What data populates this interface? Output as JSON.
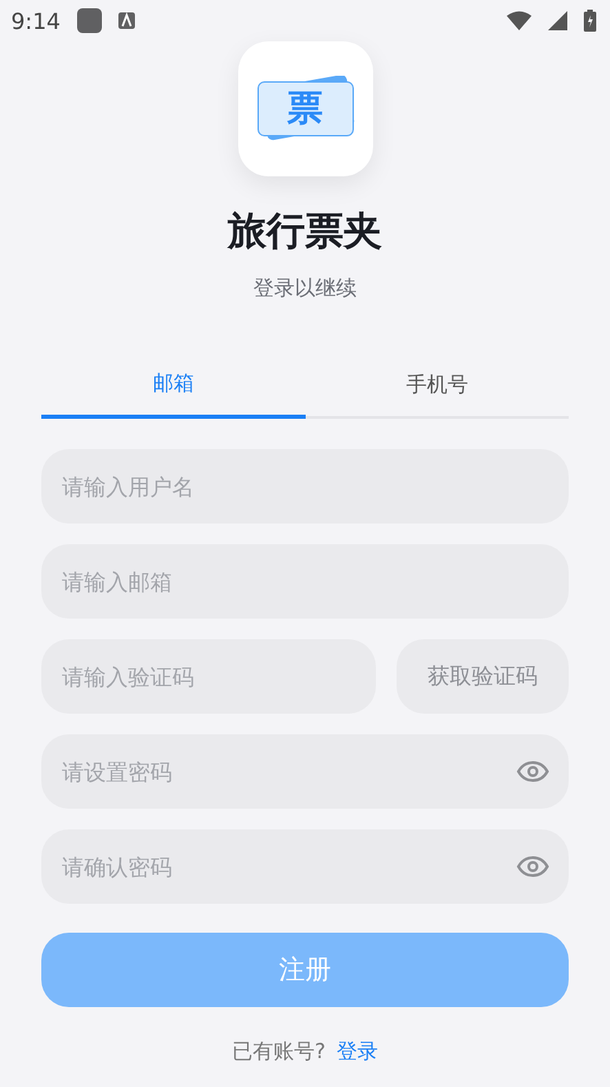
{
  "status_bar": {
    "time": "9:14"
  },
  "logo": {
    "glyph": "票"
  },
  "title": "旅行票夹",
  "subtitle": "登录以继续",
  "tabs": [
    {
      "label": "邮箱",
      "selected": true
    },
    {
      "label": "手机号",
      "selected": false
    }
  ],
  "fields": [
    {
      "kind": "text",
      "placeholder": "请输入用户名"
    },
    {
      "kind": "text",
      "placeholder": "请输入邮箱"
    },
    {
      "kind": "code",
      "placeholder": "请输入验证码",
      "button": "获取验证码"
    },
    {
      "kind": "password",
      "placeholder": "请设置密码"
    },
    {
      "kind": "password",
      "placeholder": "请确认密码"
    }
  ],
  "submit": {
    "label": "注册",
    "disabled": true
  },
  "footer": {
    "text": "已有账号?",
    "link": "登录"
  }
}
